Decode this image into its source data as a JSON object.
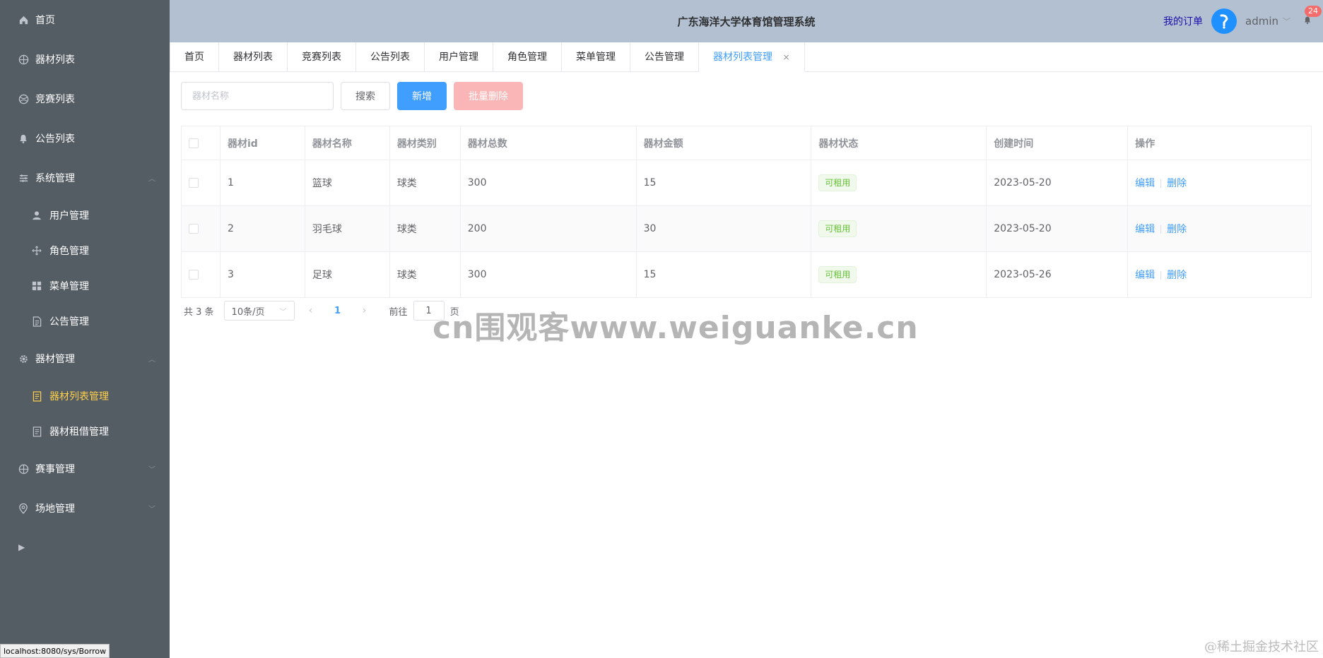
{
  "header": {
    "title": "广东海洋大学体育馆管理系统",
    "my_orders": "我的订单",
    "user_name": "admin",
    "notification_count": "24"
  },
  "sidebar": {
    "items": [
      {
        "label": "首页",
        "icon": "home-icon"
      },
      {
        "label": "器材列表",
        "icon": "basketball-icon"
      },
      {
        "label": "竞赛列表",
        "icon": "ball-icon"
      },
      {
        "label": "公告列表",
        "icon": "bell-icon"
      }
    ],
    "groups": [
      {
        "label": "系统管理",
        "icon": "sliders-icon",
        "expanded": true,
        "children": [
          {
            "label": "用户管理",
            "icon": "user-icon"
          },
          {
            "label": "角色管理",
            "icon": "rank-icon"
          },
          {
            "label": "菜单管理",
            "icon": "menu-icon"
          },
          {
            "label": "公告管理",
            "icon": "document-icon"
          }
        ]
      },
      {
        "label": "器材管理",
        "icon": "gear-icon",
        "expanded": true,
        "children": [
          {
            "label": "器材列表管理",
            "icon": "tickets-icon",
            "active": true
          },
          {
            "label": "器材租借管理",
            "icon": "tickets-icon"
          }
        ]
      },
      {
        "label": "赛事管理",
        "icon": "basketball-icon",
        "expanded": false
      },
      {
        "label": "场地管理",
        "icon": "location-icon",
        "expanded": false
      }
    ],
    "status_url": "localhost:8080/sys/Borrow"
  },
  "tabs": [
    {
      "label": "首页"
    },
    {
      "label": "器材列表"
    },
    {
      "label": "竞赛列表"
    },
    {
      "label": "公告列表"
    },
    {
      "label": "用户管理"
    },
    {
      "label": "角色管理"
    },
    {
      "label": "菜单管理"
    },
    {
      "label": "公告管理"
    },
    {
      "label": "器材列表管理",
      "active": true,
      "closable": true
    }
  ],
  "toolbar": {
    "search_placeholder": "器材名称",
    "search_label": "搜索",
    "add_label": "新增",
    "batch_delete_label": "批量删除"
  },
  "table": {
    "headers": [
      "器材id",
      "器材名称",
      "器材类别",
      "器材总数",
      "器材金额",
      "器材状态",
      "创建时间",
      "操作"
    ],
    "rows": [
      {
        "id": "1",
        "name": "篮球",
        "category": "球类",
        "total": "300",
        "amount": "15",
        "status": "可租用",
        "created": "2023-05-20"
      },
      {
        "id": "2",
        "name": "羽毛球",
        "category": "球类",
        "total": "200",
        "amount": "30",
        "status": "可租用",
        "created": "2023-05-20"
      },
      {
        "id": "3",
        "name": "足球",
        "category": "球类",
        "total": "300",
        "amount": "15",
        "status": "可租用",
        "created": "2023-05-26"
      }
    ],
    "edit_label": "编辑",
    "delete_label": "删除"
  },
  "pagination": {
    "total_text": "共 3 条",
    "page_size": "10条/页",
    "current_page": "1",
    "goto_prefix": "前往",
    "goto_value": "1",
    "goto_suffix": "页"
  },
  "watermarks": {
    "center": "cn围观客www.weiguanke.cn",
    "corner": "@稀土掘金技术社区"
  },
  "colors": {
    "sidebar_bg": "#545c64",
    "header_bg": "#b3c0d1",
    "active_menu": "#ffd04b",
    "primary": "#409eff",
    "success": "#67c23a",
    "danger_disabled": "#fab6b6"
  }
}
